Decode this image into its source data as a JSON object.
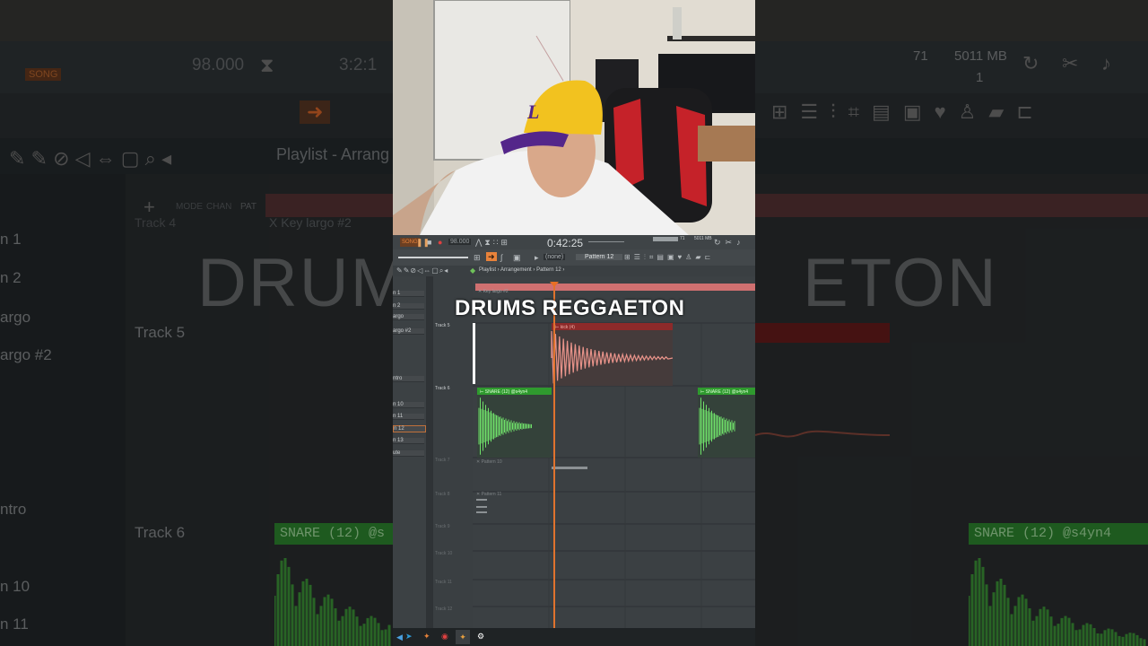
{
  "background": {
    "big_text_left": "DRUMS",
    "big_text_right": "ETON",
    "playlist_label": "Playlist - Arrang",
    "pattern_fragment": "X Key largo #2",
    "bpm_display": "98.000",
    "time_sig": "3:2:1",
    "song_label": "SONG",
    "pat_label": "PAT",
    "mode_labels": [
      "MODE",
      "CHAN"
    ],
    "track5": "Track 5",
    "track6": "Track 6",
    "left_items": [
      "n 1",
      "n 2",
      "argo",
      "argo #2",
      "ntro",
      "n 10",
      "n 11"
    ],
    "snare_left": "SNARE (12) @s",
    "snare_right": "SNARE (12) @s4yn4",
    "cpu_value": "71",
    "mem_value": "5011 MB",
    "mem_sub": "1"
  },
  "video": {
    "caption": "DRUMS REGGAETON"
  },
  "fl": {
    "tempo": "98.000",
    "time": "0:42:25",
    "pattern_selector": "Pattern 12",
    "none_label": "(none)",
    "cpu": "71",
    "mem": "5011 MB",
    "breadcrumb": [
      "Playlist",
      "Arrangement",
      "Pattern 12"
    ],
    "track_list": [
      "n 1",
      "n 2",
      "argo",
      "argo #2",
      "ntro",
      "n 10",
      "n 11",
      "n 12",
      "n 13",
      "ute"
    ],
    "tracks": [
      "Track 5",
      "Track 6",
      "Track 7",
      "Track 8",
      "Track 9",
      "Track 10",
      "Track 11",
      "Track 12"
    ],
    "clips": {
      "kick": "kick (4)",
      "snare1": "SNARE (12) @s4yn4",
      "snare2": "SNARE (12) @s4yn4",
      "pattern10": "Pattern 10",
      "pattern11": "Pattern 11",
      "keylargo": "Key largo #2"
    }
  },
  "colors": {
    "kick_clip": "#e8938a",
    "snare_clip": "#6fe06a",
    "playhead": "#e0732e",
    "accent_orange": "#e86f25"
  }
}
